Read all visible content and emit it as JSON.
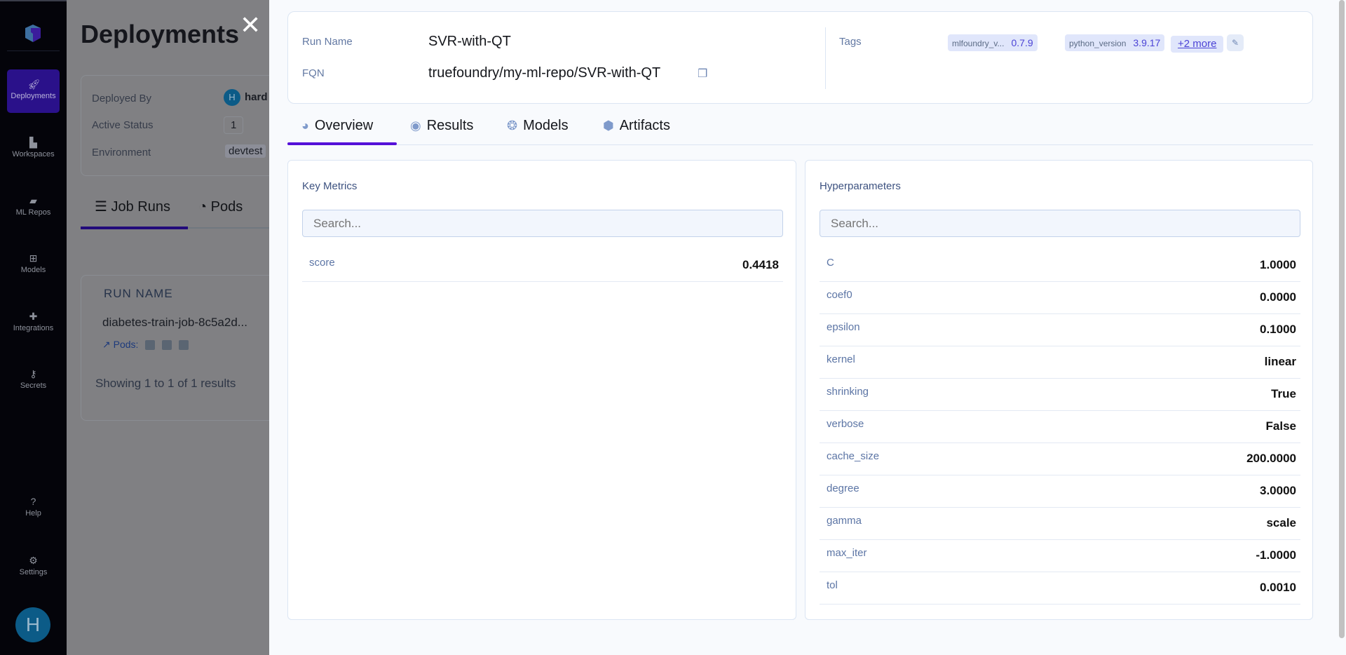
{
  "sidebar": {
    "items": [
      {
        "label": "Deployments",
        "icon": "rocket-icon"
      },
      {
        "label": "Workspaces",
        "icon": "workspaces-icon"
      },
      {
        "label": "ML Repos",
        "icon": "folder-icon"
      },
      {
        "label": "Models",
        "icon": "table-icon"
      },
      {
        "label": "Integrations",
        "icon": "puzzle-icon"
      },
      {
        "label": "Secrets",
        "icon": "key-icon"
      },
      {
        "label": "Help",
        "icon": "question-icon"
      },
      {
        "label": "Settings",
        "icon": "gear-icon"
      }
    ],
    "avatar": "H"
  },
  "background": {
    "title": "Deployments",
    "deployed_by_label": "Deployed By",
    "deployed_by_avatar": "H",
    "deployed_by": "hard",
    "active_status_label": "Active Status",
    "active_count": "1",
    "environment_label": "Environment",
    "environment": "devtest",
    "tabs": [
      "Job Runs",
      "Pods"
    ],
    "column": "RUN NAME",
    "run": "diabetes-train-job-8c5a2d...",
    "pods_label": "Pods:",
    "showing": "Showing 1 to 1 of 1 results"
  },
  "drawer": {
    "run_name_label": "Run Name",
    "run_name": "SVR-with-QT",
    "fqn_label": "FQN",
    "fqn": "truefoundry/my-ml-repo/SVR-with-QT",
    "tags_label": "Tags",
    "tags": [
      {
        "key": "mlfoundry_v...",
        "value": "0.7.9"
      },
      {
        "key": "python_version",
        "value": "3.9.17"
      }
    ],
    "more_tags": "+2 more",
    "tabs": [
      "Overview",
      "Results",
      "Models",
      "Artifacts"
    ],
    "active_tab": "Overview",
    "key_metrics": {
      "title": "Key Metrics",
      "placeholder": "Search...",
      "rows": [
        {
          "k": "score",
          "v": "0.4418"
        }
      ]
    },
    "hyperparameters": {
      "title": "Hyperparameters",
      "placeholder": "Search...",
      "rows": [
        {
          "k": "C",
          "v": "1.0000"
        },
        {
          "k": "coef0",
          "v": "0.0000"
        },
        {
          "k": "epsilon",
          "v": "0.1000"
        },
        {
          "k": "kernel",
          "v": "linear"
        },
        {
          "k": "shrinking",
          "v": "True"
        },
        {
          "k": "verbose",
          "v": "False"
        },
        {
          "k": "cache_size",
          "v": "200.0000"
        },
        {
          "k": "degree",
          "v": "3.0000"
        },
        {
          "k": "gamma",
          "v": "scale"
        },
        {
          "k": "max_iter",
          "v": "-1.0000"
        },
        {
          "k": "tol",
          "v": "0.0010"
        }
      ]
    }
  },
  "colors": {
    "accent": "#5510d9",
    "sidebar_active": "#2a118a",
    "tag_value": "#4b43d6"
  }
}
